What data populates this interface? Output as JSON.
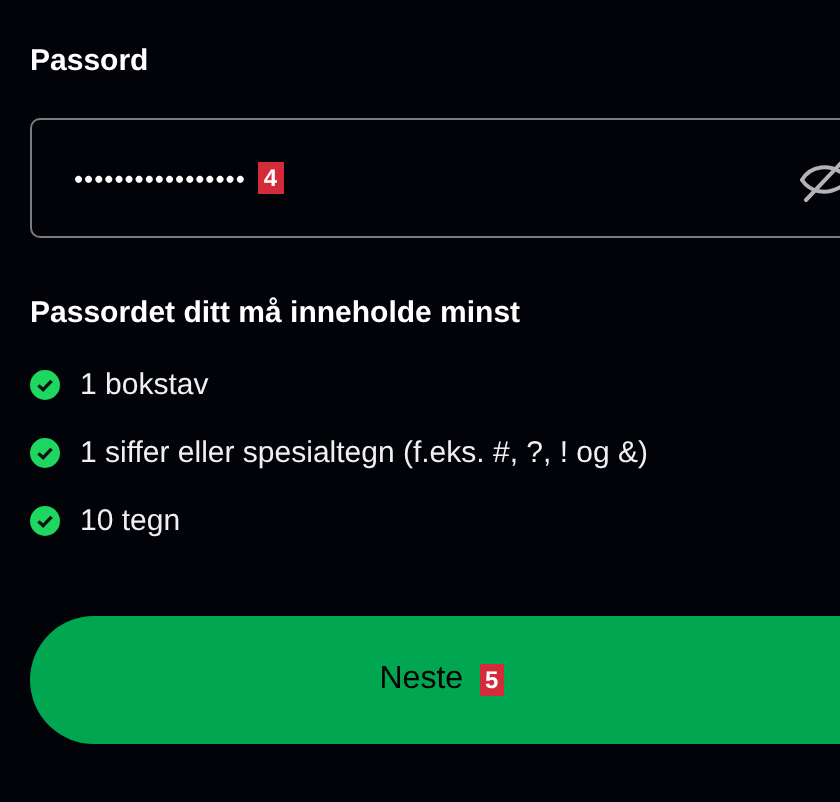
{
  "password": {
    "label": "Passord",
    "value": "•••••••••••••••••",
    "marker": "4"
  },
  "requirements": {
    "heading": "Passordet ditt må inneholde minst",
    "items": [
      {
        "text": "1 bokstav",
        "met": true
      },
      {
        "text": "1 siffer eller spesialtegn (f.eks. #, ?, ! og &)",
        "met": true
      },
      {
        "text": "10 tegn",
        "met": true
      }
    ]
  },
  "next_button": {
    "label": "Neste",
    "marker": "5"
  }
}
